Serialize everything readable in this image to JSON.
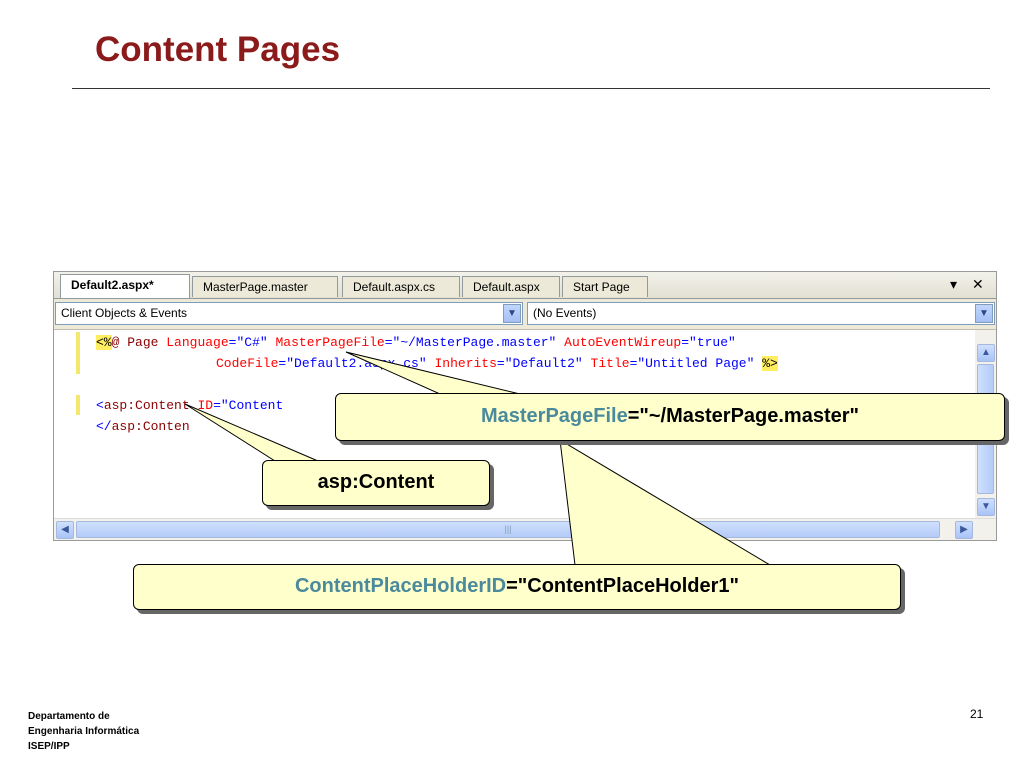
{
  "slide": {
    "title": "Content Pages",
    "page_number": "21",
    "footer_lines": [
      "Departamento de",
      "Engenharia Informática",
      "ISEP/IPP"
    ]
  },
  "ide": {
    "tabs": [
      "Default2.aspx*",
      "MasterPage.master",
      "Default.aspx.cs",
      "Default.aspx",
      "Start Page"
    ],
    "tab_controls": {
      "dropdown": "▾",
      "close": "✕"
    },
    "object_combo": "Client Objects & Events",
    "event_combo": "(No Events)",
    "code": {
      "line1": {
        "open": "<%",
        "directive": "@ Page",
        "language_attr": "Language",
        "language_val": "\"C#\"",
        "masterpage_attr": "MasterPageFile",
        "masterpage_val": "\"~/MasterPage.master\"",
        "autowire_attr": "AutoEventWireup",
        "autowire_val": "\"true\""
      },
      "line2": {
        "codefile_attr": "CodeFile",
        "codefile_val": "\"Default2.aspx.cs\"",
        "inherits_attr": "Inherits",
        "inherits_val": "\"Default2\"",
        "title_attr": "Title",
        "title_val": "\"Untitled Page\"",
        "close": "%>"
      },
      "line3": {
        "open": "<",
        "tag": "asp:Content",
        "id_attr": "ID",
        "id_val": "\"Content"
      },
      "line4": {
        "open": "</",
        "tag": "asp:Conten"
      }
    }
  },
  "callouts": {
    "masterpage": {
      "attr": "MasterPageFile",
      "rest": "=\"~/MasterPage.master\""
    },
    "content": {
      "text": "asp:Content"
    },
    "placeholder": {
      "attr": "ContentPlaceHolderID",
      "rest": "=\"ContentPlaceHolder1\""
    }
  },
  "colors": {
    "title": "#8b1a1a",
    "callout_fill": "#ffffcc",
    "callout_highlight": "#4a8a9c",
    "code_tag": "#8b0000",
    "code_attr": "#ff0000",
    "code_value": "#0000ff",
    "delimiter_highlight": "#ffee62"
  },
  "icons": [
    "chevron-down-icon",
    "close-icon",
    "scroll-up-icon",
    "scroll-down-icon",
    "scroll-left-icon",
    "scroll-right-icon"
  ]
}
